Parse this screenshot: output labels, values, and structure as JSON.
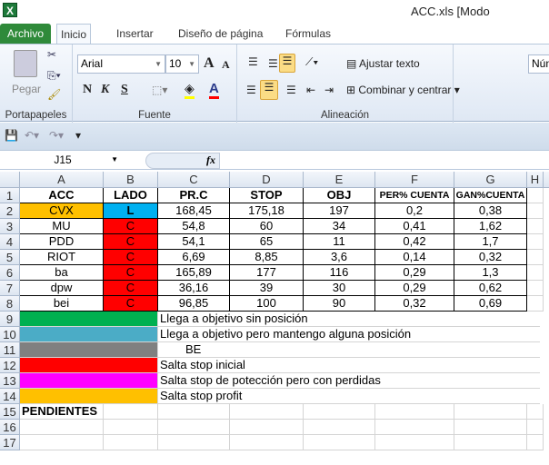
{
  "window": {
    "title": "ACC.xls  [Modo",
    "app_icon": "X"
  },
  "tabs": [
    "Archivo",
    "Inicio",
    "Insertar",
    "Diseño de página",
    "Fórmulas"
  ],
  "ribbon": {
    "clipboard": {
      "paste": "Pegar",
      "label": "Portapapeles"
    },
    "font": {
      "name": "Arial",
      "size": "10",
      "bold": "N",
      "italic": "K",
      "underline": "S",
      "grow": "A",
      "shrink": "A",
      "color": "A",
      "label": "Fuente",
      "fill_color": "#ffff00",
      "font_color": "#ff0000"
    },
    "alignment": {
      "wrap": "Ajustar texto",
      "merge": "Combinar y centrar",
      "label": "Alineación"
    },
    "number": {
      "format": "Núm"
    }
  },
  "formula_bar": {
    "name_box": "J15",
    "fx": "fx",
    "value": ""
  },
  "columns": [
    "A",
    "B",
    "C",
    "D",
    "E",
    "F",
    "G",
    "H"
  ],
  "rows": [
    "1",
    "2",
    "3",
    "4",
    "5",
    "6",
    "7",
    "8",
    "9",
    "10",
    "11",
    "12",
    "13",
    "14",
    "15",
    "16",
    "17"
  ],
  "table": {
    "headers": [
      "ACC",
      "LADO",
      "PR.C",
      "STOP",
      "OBJ",
      "PER% CUENTA",
      "GAN%CUENTA"
    ],
    "data": [
      [
        "CVX",
        "L",
        "168,45",
        "175,18",
        "197",
        "0,2",
        "0,38"
      ],
      [
        "MU",
        "C",
        "54,8",
        "60",
        "34",
        "0,41",
        "1,62"
      ],
      [
        "PDD",
        "C",
        "54,1",
        "65",
        "11",
        "0,42",
        "1,7"
      ],
      [
        "RIOT",
        "C",
        "6,69",
        "8,85",
        "3,6",
        "0,14",
        "0,32"
      ],
      [
        "ba",
        "C",
        "165,89",
        "177",
        "116",
        "0,29",
        "1,3"
      ],
      [
        "dpw",
        "C",
        "36,16",
        "39",
        "30",
        "0,29",
        "0,62"
      ],
      [
        "bei",
        "C",
        "96,85",
        "100",
        "90",
        "0,32",
        "0,69"
      ]
    ]
  },
  "legend": [
    {
      "color": "#00b050",
      "text": "Llega a objetivo sin posición"
    },
    {
      "color": "#4bacc6",
      "text": "Llega a objetivo pero mantengo alguna posición"
    },
    {
      "color": "#808080",
      "text": "BE"
    },
    {
      "color": "#ff0000",
      "text": "Salta stop inicial"
    },
    {
      "color": "#ff00ff",
      "text": "Salta stop de potección pero con perdidas"
    },
    {
      "color": "#ffc000",
      "text": "Salta stop profit"
    }
  ],
  "pending": "PENDIENTES",
  "colors": {
    "cvx": "#ffc000",
    "long": "#00b0f0",
    "short": "#ff0000"
  }
}
